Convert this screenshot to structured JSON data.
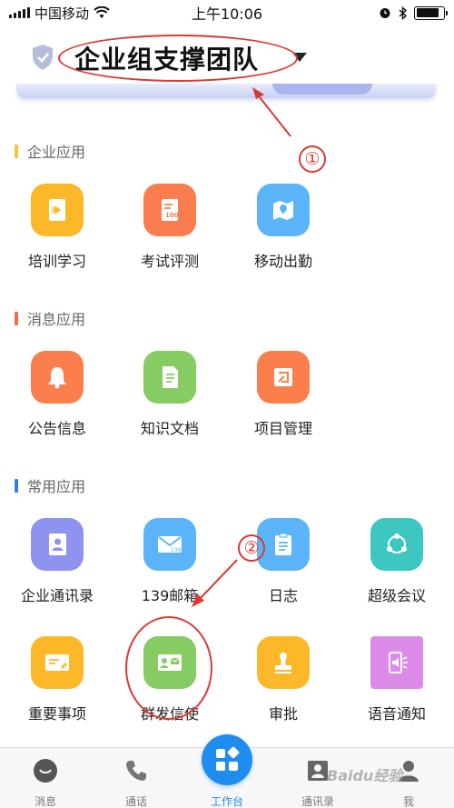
{
  "status_bar": {
    "carrier": "中国移动",
    "time": "上午10:06",
    "battery_level": 0.85
  },
  "header": {
    "team_name": "企业组支撑团队"
  },
  "annotations": {
    "marker_1": "①",
    "marker_2": "②"
  },
  "colors": {
    "annotation": "#d93a32",
    "accent": "#1f8cf0"
  },
  "sections": [
    {
      "title": "企业应用",
      "bar_color": "#f6c342",
      "apps": [
        {
          "label": "培训学习",
          "icon": "play-book-icon",
          "color": "#fcb828"
        },
        {
          "label": "考试评测",
          "icon": "exam-sheet-icon",
          "color": "#fb7d4f"
        },
        {
          "label": "移动出勤",
          "icon": "map-pin-icon",
          "color": "#5ab4f7"
        }
      ]
    },
    {
      "title": "消息应用",
      "bar_color": "#f26d4b",
      "apps": [
        {
          "label": "公告信息",
          "icon": "bell-icon",
          "color": "#fb7e4d"
        },
        {
          "label": "知识文档",
          "icon": "document-icon",
          "color": "#86cc62"
        },
        {
          "label": "项目管理",
          "icon": "project-icon",
          "color": "#fb7e4d"
        }
      ]
    },
    {
      "title": "常用应用",
      "bar_color": "#2f7ff0",
      "apps": [
        {
          "label": "企业通讯录",
          "icon": "contacts-book-icon",
          "color": "#8d93ee"
        },
        {
          "label": "139邮箱",
          "icon": "mail-139-icon",
          "color": "#5ab4f7"
        },
        {
          "label": "日志",
          "icon": "clipboard-icon",
          "color": "#5ab4f7"
        },
        {
          "label": "超级会议",
          "icon": "conference-icon",
          "color": "#3ec7c0"
        },
        {
          "label": "重要事项",
          "icon": "note-icon",
          "color": "#fcb828"
        },
        {
          "label": "群发信使",
          "icon": "group-message-icon",
          "color": "#86cc62"
        },
        {
          "label": "审批",
          "icon": "stamp-icon",
          "color": "#fcb828"
        },
        {
          "label": "语音通知",
          "icon": "voice-phone-icon",
          "color": "#dd8be8"
        }
      ]
    }
  ],
  "bottom_nav": [
    {
      "label": "消息",
      "icon": "chat-bubble-icon"
    },
    {
      "label": "通话",
      "icon": "phone-icon"
    },
    {
      "label": "工作台",
      "icon": "workbench-icon",
      "active": true
    },
    {
      "label": "通讯录",
      "icon": "contacts-icon"
    },
    {
      "label": "我",
      "icon": "profile-icon"
    }
  ],
  "watermark": "Baidu经验"
}
